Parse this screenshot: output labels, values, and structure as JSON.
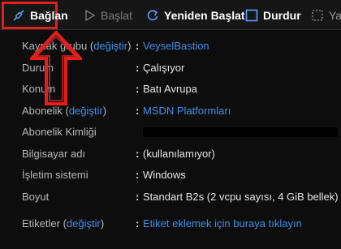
{
  "toolbar": {
    "connect_label": "Bağlan",
    "start_label": "Başlat",
    "restart_label": "Yeniden Başlat",
    "stop_label": "Durdur",
    "more_label": "Ya"
  },
  "properties": {
    "resource_group": {
      "key": "Kaynak grubu",
      "change": "değiştir",
      "value": "VeyselBastion"
    },
    "status": {
      "key": "Durum",
      "value": "Çalışıyor"
    },
    "location": {
      "key": "Konum",
      "value": "Batı Avrupa"
    },
    "subscription": {
      "key": "Abonelik",
      "change": "değiştir",
      "value": "MSDN Platformları"
    },
    "subscription_id": {
      "key": "Abonelik Kimliği"
    },
    "computer_name": {
      "key": "Bilgisayar adı",
      "value": "(kullanılamıyor)"
    },
    "os": {
      "key": "İşletim sistemi",
      "value": "Windows"
    },
    "size": {
      "key": "Boyut",
      "value": "Standart B2s (2 vcpu sayısı, 4 GiB bellek)"
    },
    "tags": {
      "key": "Etiketler",
      "change": "değiştir",
      "value": "Etiket eklemek için buraya tıklayın"
    }
  },
  "punct": {
    "open_paren": " (",
    "close_paren": ")",
    "colon": ":"
  },
  "colors": {
    "accent_link": "#3f8fe8",
    "highlight_red": "#e0201c"
  },
  "icons": {
    "connect": "plug-icon",
    "start": "play-icon",
    "restart": "restart-icon",
    "stop": "stop-icon",
    "more": "more-icon"
  }
}
